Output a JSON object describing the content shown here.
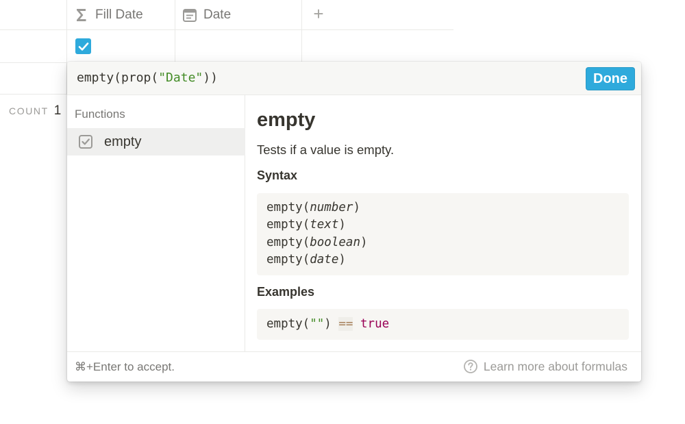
{
  "table": {
    "columns": [
      {
        "label": "Fill Date",
        "icon": "sigma-formula-icon"
      },
      {
        "label": "Date",
        "icon": "calendar-icon"
      }
    ],
    "add_column_icon": "plus-icon",
    "row_checkbox_checked": true,
    "count_label": "COUNT",
    "count_value": "1"
  },
  "formula_editor": {
    "formula_prefix": "empty(prop(",
    "formula_string": "\"Date\"",
    "formula_suffix": "))",
    "done_label": "Done",
    "functions_heading": "Functions",
    "functions": [
      {
        "name": "empty",
        "icon": "checkbox-icon",
        "selected": true
      }
    ],
    "detail": {
      "title": "empty",
      "description": "Tests if a value is empty.",
      "syntax_heading": "Syntax",
      "syntax": [
        {
          "fn": "empty",
          "arg": "number"
        },
        {
          "fn": "empty",
          "arg": "text"
        },
        {
          "fn": "empty",
          "arg": "boolean"
        },
        {
          "fn": "empty",
          "arg": "date"
        }
      ],
      "examples_heading": "Examples",
      "example": {
        "call_prefix": "empty(",
        "call_string": "\"\"",
        "call_suffix": ")",
        "operator": "==",
        "result": "true"
      }
    },
    "footer": {
      "shortcut_hint": "⌘+Enter to accept.",
      "learn_more": "Learn more about formulas",
      "learn_more_icon": "help-circle-icon"
    }
  },
  "colors": {
    "accent": "#2eaadc",
    "string": "#448c27",
    "keyword": "#990055",
    "operator": "#a67f59"
  }
}
